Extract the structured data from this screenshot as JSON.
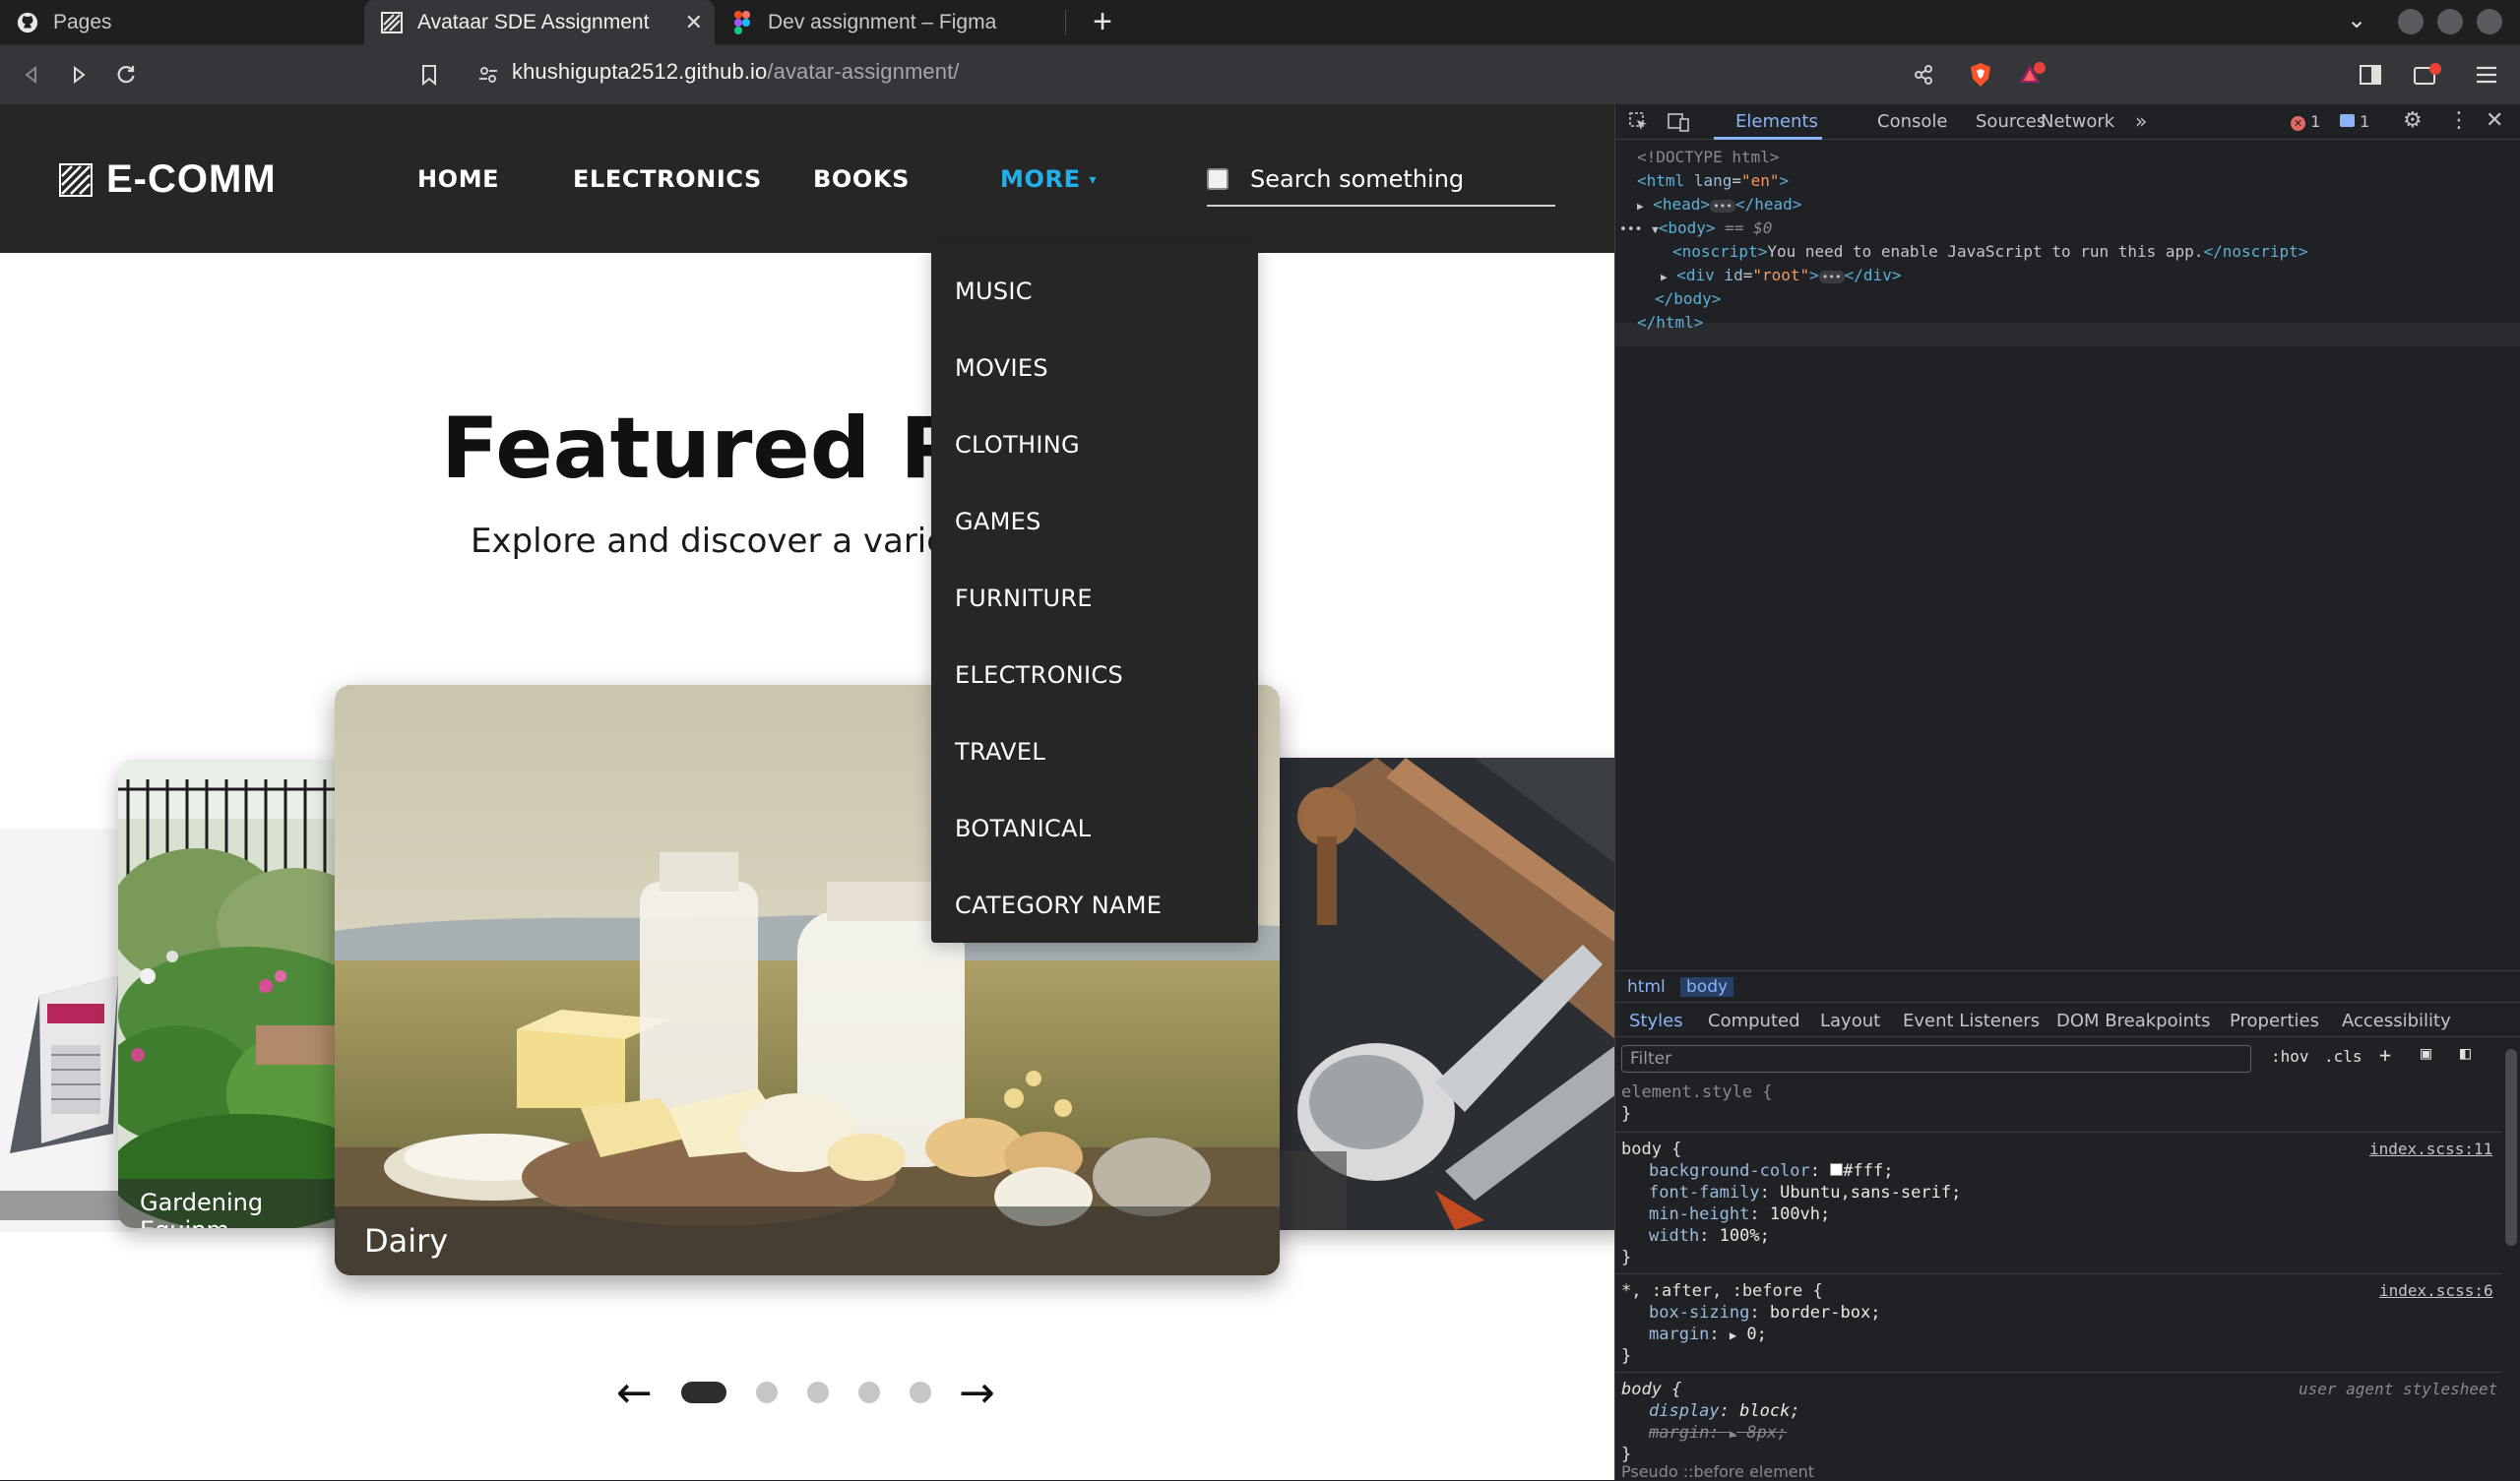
{
  "browser": {
    "tabs": [
      {
        "title": "Pages",
        "icon": "github-icon"
      },
      {
        "title": "Avataar SDE Assignment",
        "icon": "site-icon"
      },
      {
        "title": "Dev assignment – Figma",
        "icon": "figma-icon"
      }
    ],
    "url_host": "khushigupta2512.github.io",
    "url_path": "/avatar-assignment/"
  },
  "site": {
    "logo": "E-COMM",
    "nav": [
      "HOME",
      "ELECTRONICS",
      "BOOKS",
      "MORE"
    ],
    "more_caret": "▾",
    "search_placeholder": "Search something",
    "dropdown": [
      "MUSIC",
      "MOVIES",
      "CLOTHING",
      "GAMES",
      "FURNITURE",
      "ELECTRONICS",
      "TRAVEL",
      "BOTANICAL",
      "CATEGORY NAME"
    ],
    "hero_title": "Featured Pro",
    "hero_sub": "Explore and discover a variet",
    "cards": [
      {
        "caption": "Gardening Equipm"
      },
      {
        "caption": "Dairy"
      }
    ],
    "carousel": {
      "prev": "←",
      "next": "→",
      "dot_count": 5,
      "active_index": 0
    }
  },
  "devtools": {
    "tabs": [
      "Elements",
      "Console",
      "Sources",
      "Network"
    ],
    "error_count": "1",
    "message_count": "1",
    "dom": {
      "doctype": "<!DOCTYPE html>",
      "html_open_tag": "html",
      "html_lang_attr": "lang",
      "html_lang_val": "\"en\"",
      "head_line": "<head>",
      "head_close": "</head>",
      "body_line": "<body>",
      "body_eq": " == $0",
      "noscript_open": "<noscript>",
      "noscript_text": "You need to enable JavaScript to run this app.",
      "noscript_close": "</noscript>",
      "div_open": "<div",
      "div_attr_name": " id",
      "div_attr_val": "\"root\"",
      "div_close": "</div>",
      "body_close": "</body>",
      "html_close": "</html>"
    },
    "breadcrumbs": [
      "html",
      "body"
    ],
    "subtabs": [
      "Styles",
      "Computed",
      "Layout",
      "Event Listeners",
      "DOM Breakpoints",
      "Properties",
      "Accessibility"
    ],
    "filter_placeholder": "Filter",
    "hov": ":hov",
    "cls": ".cls",
    "styles": {
      "element_style": "element.style {",
      "close_brace": "}",
      "body_rule": "body {",
      "body_src": "index.scss:11",
      "bg_prop": "background-color",
      "bg_val": "#fff;",
      "ff_prop": "font-family",
      "ff_val": "Ubuntu,sans-serif;",
      "mh_prop": "min-height",
      "mh_val": "100vh;",
      "w_prop": "width",
      "w_val": "100%;",
      "star_rule": "*, :after, :before {",
      "star_src": "index.scss:6",
      "bs_prop": "box-sizing",
      "bs_val": "border-box;",
      "m_prop": "margin",
      "m_val": "0;",
      "ua_rule": "body {",
      "ua_src": "user agent stylesheet",
      "disp_prop": "display",
      "disp_val": "block;",
      "ua_margin_prop": "margin",
      "ua_margin_val": "8px;",
      "pseudo": "Pseudo ::before element"
    }
  },
  "colors": {
    "accent": "#23b0e8",
    "nav_bg": "#262626",
    "devtools_bg": "#202124"
  }
}
